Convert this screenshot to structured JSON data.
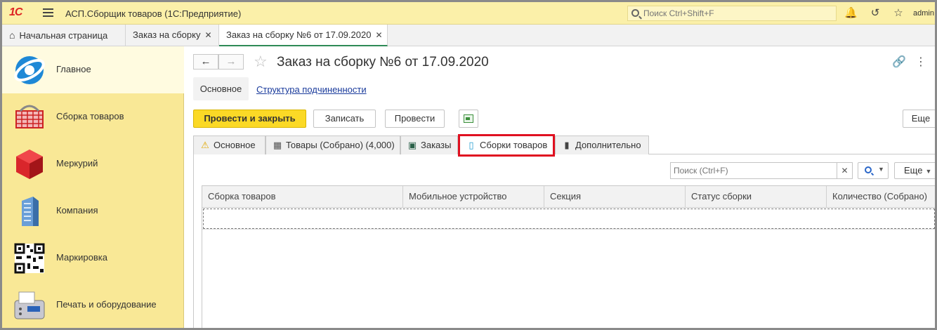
{
  "app": {
    "logo": "1С",
    "title": "АСП.Сборщик товаров  (1С:Предприятие)",
    "search_placeholder": "Поиск Ctrl+Shift+F",
    "user": "admin"
  },
  "open_tabs": [
    {
      "label": "Начальная страница"
    },
    {
      "label": "Заказ на сборку"
    },
    {
      "label": "Заказ на сборку №6 от 17.09.2020"
    }
  ],
  "sidebar": {
    "items": [
      {
        "label": "Главное"
      },
      {
        "label": "Сборка товаров"
      },
      {
        "label": "Меркурий"
      },
      {
        "label": "Компания"
      },
      {
        "label": "Маркировка"
      },
      {
        "label": "Печать и оборудование"
      }
    ]
  },
  "document": {
    "title": "Заказ на сборку №6 от 17.09.2020",
    "subnav": {
      "active": "Основное",
      "link": "Структура подчиненности"
    }
  },
  "toolbar": {
    "post_close": "Провести и закрыть",
    "save": "Записать",
    "post": "Провести",
    "more": "Еще"
  },
  "form_tabs": [
    {
      "label": "Основное",
      "icon": "warning-icon"
    },
    {
      "label": "Товары (Собрано) (4,000)",
      "icon": "building-icon"
    },
    {
      "label": "Заказы",
      "icon": "card-icon"
    },
    {
      "label": "Сборки товаров",
      "icon": "mobile-icon"
    },
    {
      "label": "Дополнительно",
      "icon": "comment-icon"
    }
  ],
  "table": {
    "search_placeholder": "Поиск (Ctrl+F)",
    "more": "Еще",
    "columns": [
      "Сборка товаров",
      "Мобильное устройство",
      "Секция",
      "Статус сборки",
      "Количество (Собрано)"
    ]
  },
  "colors": {
    "accent_yellow": "#fbd926",
    "sidebar": "#f9e896",
    "highlight": "#e01020",
    "link": "#1a3b9c"
  }
}
